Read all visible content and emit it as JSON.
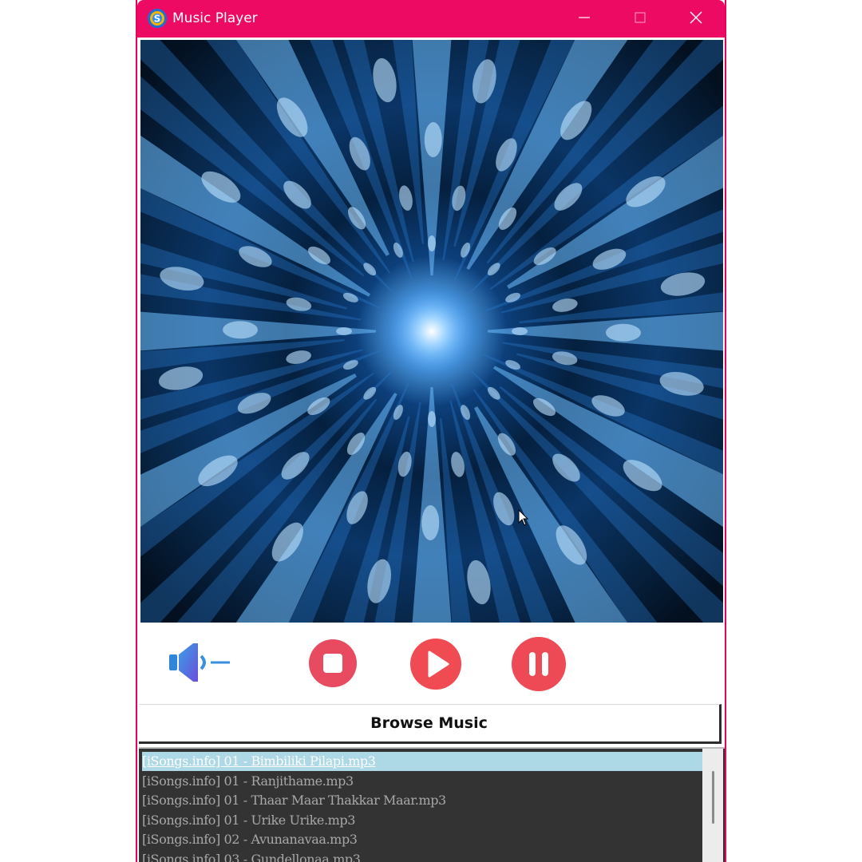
{
  "window": {
    "title": "Music Player",
    "accent_color": "#ec0a62"
  },
  "titlebar": {
    "app_icon": "app-logo-icon",
    "minimize_icon": "minimize-icon",
    "maximize_icon": "maximize-icon",
    "close_icon": "close-icon"
  },
  "artwork": {
    "icon": "radial-blue-light-burst"
  },
  "controls": {
    "volume_icon": "volume-speaker-icon",
    "stop_icon": "stop-icon",
    "play_icon": "play-icon",
    "pause_icon": "pause-icon",
    "button_color": "#ec4a5c"
  },
  "browse": {
    "label": "Browse Music"
  },
  "playlist": {
    "selected_index": 0,
    "selected_color": "#add8e6",
    "items": [
      "[iSongs.info] 01 - Bimbiliki Pilapi.mp3",
      "[iSongs.info] 01 - Ranjithame.mp3",
      "[iSongs.info] 01 - Thaar Maar Thakkar Maar.mp3",
      "[iSongs.info] 01 - Urike Urike.mp3",
      "[iSongs.info] 02 - Avunanavaa.mp3",
      "[iSongs.info] 03 - Gundellonaa.mp3"
    ]
  }
}
